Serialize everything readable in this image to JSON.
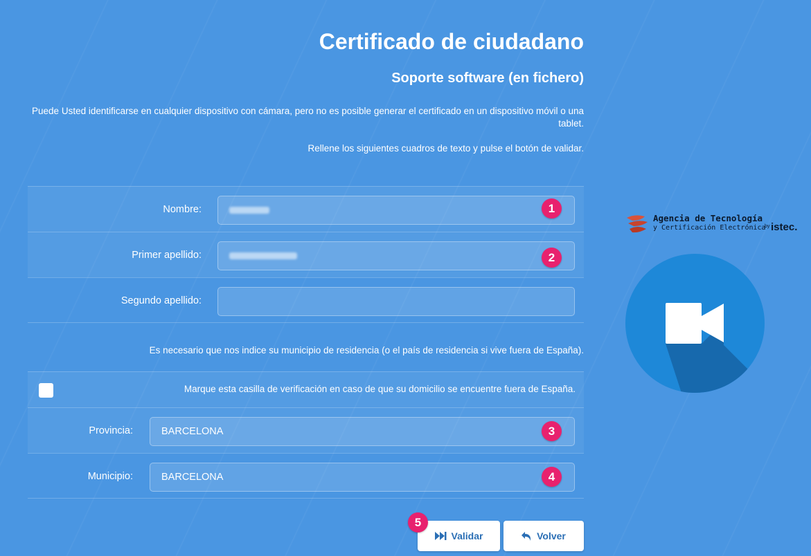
{
  "page": {
    "title": "Certificado de ciudadano",
    "subtitle": "Soporte software (en fichero)",
    "info_camera": "Puede Usted identificarse en cualquier dispositivo con cámara, pero no es posible generar el certificado en un dispositivo móvil o una tablet.",
    "info_fill": "Rellene los siguientes cuadros de texto y pulse el botón de validar."
  },
  "form": {
    "nombre_label": "Nombre:",
    "primer_apellido_label": "Primer apellido:",
    "segundo_apellido_label": "Segundo apellido:",
    "segundo_apellido_value": "",
    "residence_note": "Es necesario que nos indice su municipio de residencia (o el país de residencia si vive fuera de España).",
    "outside_spain_label": "Marque esta casilla de verificación en caso de que su domicilio se encuentre fuera de España.",
    "outside_spain_checked": false,
    "provincia_label": "Provincia:",
    "provincia_value": "BARCELONA",
    "municipio_label": "Municipio:",
    "municipio_value": "BARCELONA"
  },
  "badges": [
    "1",
    "2",
    "3",
    "4",
    "5"
  ],
  "buttons": {
    "validar": "Validar",
    "volver": "Volver"
  },
  "logo": {
    "line1": "Agencia de Tecnología",
    "line2": "y Certificación Electrónica",
    "by": "by",
    "brand": "istec."
  },
  "icons": {
    "validar": "fast-forward-icon",
    "volver": "undo-arrow-icon",
    "camera": "video-camera-icon"
  },
  "colors": {
    "background": "#4a96e2",
    "badge": "#e8216e",
    "button_text": "#2b6fb5",
    "camera_circle": "#1e88d8"
  }
}
